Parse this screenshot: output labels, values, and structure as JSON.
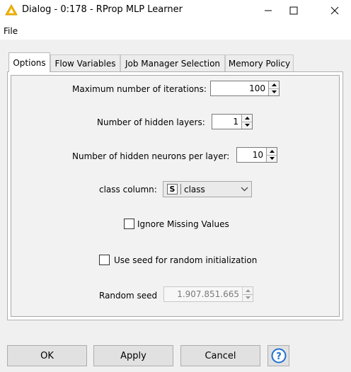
{
  "window": {
    "title": "Dialog - 0:178 - RProp MLP Learner"
  },
  "menu": {
    "file_label": "File"
  },
  "tabs": [
    {
      "label": "Options",
      "active": true
    },
    {
      "label": "Flow Variables",
      "active": false
    },
    {
      "label": "Job Manager Selection",
      "active": false
    },
    {
      "label": "Memory Policy",
      "active": false
    }
  ],
  "options": {
    "max_iterations": {
      "label": "Maximum number of iterations:",
      "value": "100"
    },
    "hidden_layers": {
      "label": "Number of hidden layers:",
      "value": "1"
    },
    "hidden_neurons": {
      "label": "Number of hidden neurons per layer:",
      "value": "10"
    },
    "class_column": {
      "label": "class column:",
      "type_badge": "S",
      "value": "class"
    },
    "ignore_missing": {
      "label": "Ignore Missing Values",
      "checked": false
    },
    "use_seed": {
      "label": "Use seed for random initialization",
      "checked": false
    },
    "random_seed": {
      "label": "Random seed",
      "value": "1.907.851.665",
      "enabled": false
    }
  },
  "buttons": {
    "ok": "OK",
    "apply": "Apply",
    "cancel": "Cancel"
  },
  "colors": {
    "accent_icon": "#f2b705",
    "help_blue": "#1f6fd1"
  },
  "icons": {
    "app": "warning-triangle-icon",
    "help": "help-icon"
  }
}
